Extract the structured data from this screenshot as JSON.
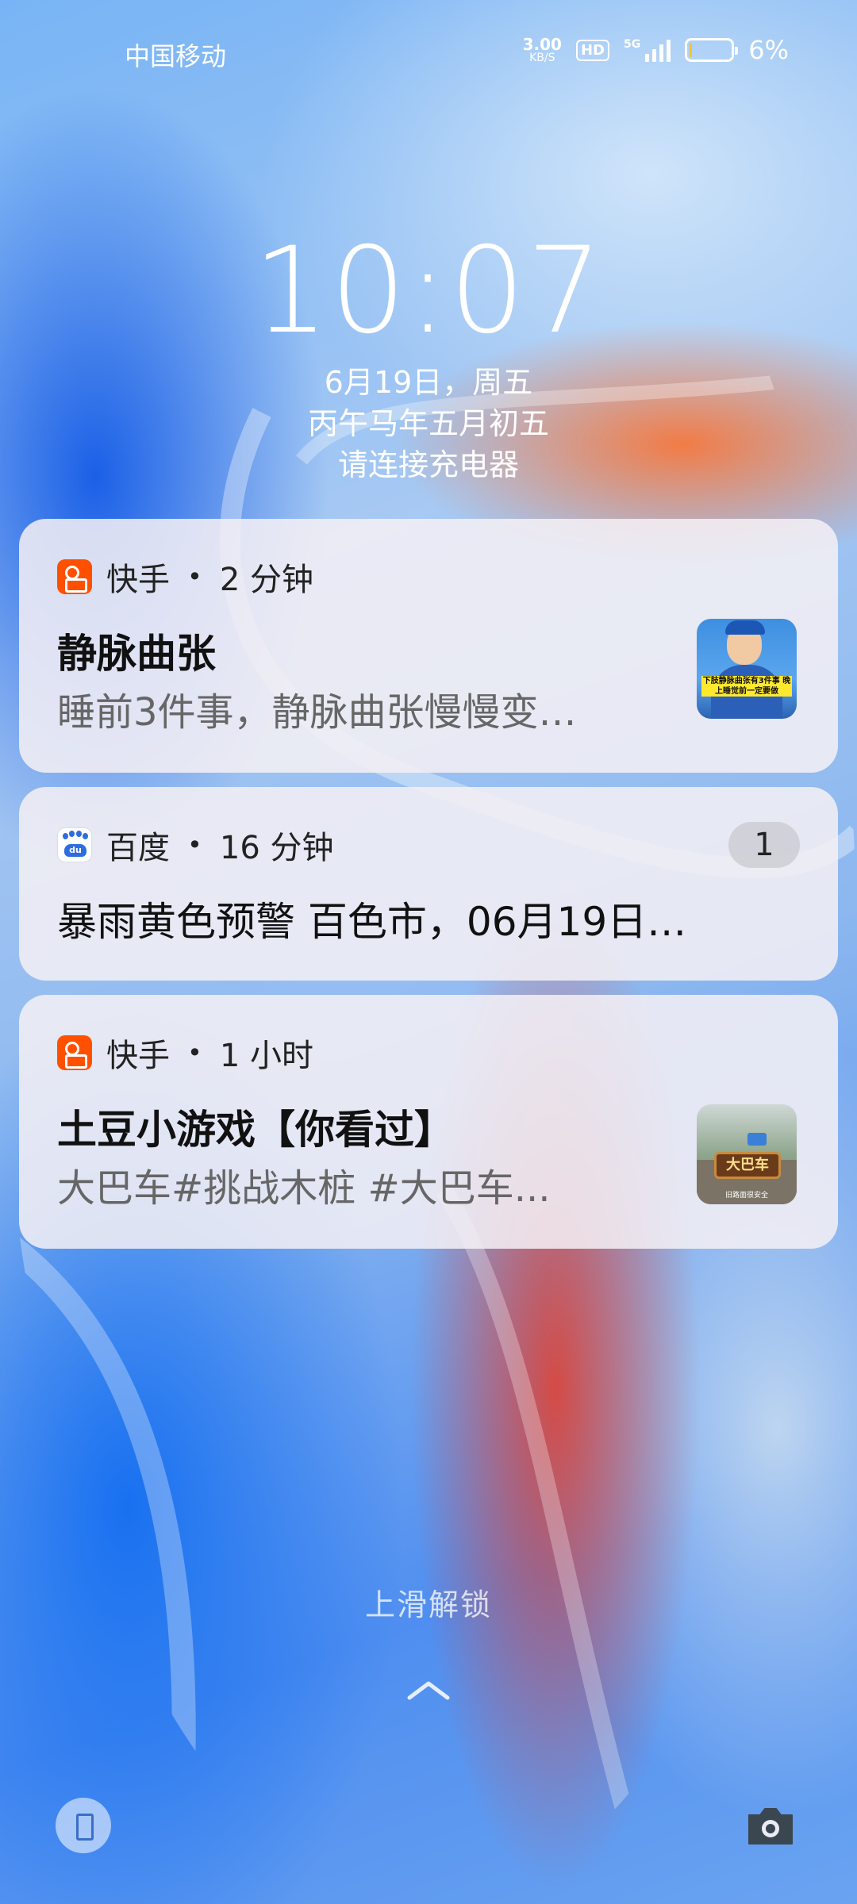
{
  "status_bar": {
    "carrier": "中国移动",
    "net_speed_value": "3.00",
    "net_speed_unit": "KB/S",
    "hd_label": "HD",
    "signal_label": "5G",
    "battery_percent": "6%",
    "battery_level": 0.06,
    "battery_color": "#f4c531"
  },
  "lockscreen": {
    "time": "10:07",
    "date": "6月19日，周五",
    "lunar_date": "丙午马年五月初五",
    "charge_hint": "请连接充电器",
    "unlock_hint": "上滑解锁"
  },
  "notifications": [
    {
      "app": "快手",
      "time_ago": "2 分钟",
      "title": "静脉曲张",
      "body": "睡前3件事，静脉曲张慢慢变…",
      "thumbnail_caption": "下肢静脉曲张有3件事 晚上睡觉前一定要做",
      "app_icon": "kuaishou-icon"
    },
    {
      "app": "百度",
      "time_ago": "16 分钟",
      "count": "1",
      "text": "暴雨黄色预警 百色市，06月19日…",
      "app_icon": "baidu-icon"
    },
    {
      "app": "快手",
      "time_ago": "1 小时",
      "title": "土豆小游戏【你看过】",
      "body": "大巴车#挑战木桩 #大巴车...",
      "thumbnail_caption": "大巴车",
      "thumbnail_sub": "旧路面很安全",
      "app_icon": "kuaishou-icon"
    }
  ],
  "colors": {
    "kuaishou_brand": "#ff5000",
    "baidu_brand": "#2f6cdf"
  }
}
